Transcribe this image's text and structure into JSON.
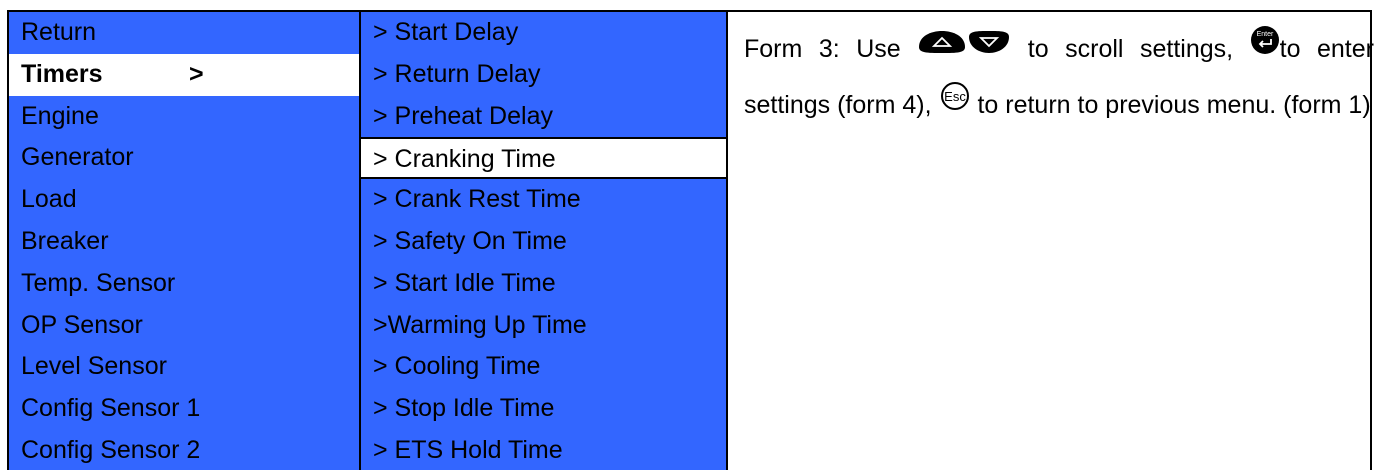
{
  "menu": {
    "items": [
      {
        "label": "Return"
      },
      {
        "label": "Timers",
        "arrow": ">"
      },
      {
        "label": "Engine"
      },
      {
        "label": "Generator"
      },
      {
        "label": "Load"
      },
      {
        "label": "Breaker"
      },
      {
        "label": "Temp. Sensor"
      },
      {
        "label": "OP Sensor"
      },
      {
        "label": "Level Sensor"
      },
      {
        "label": "Config Sensor 1"
      },
      {
        "label": "Config Sensor 2"
      }
    ],
    "selected_index": 1
  },
  "submenu": {
    "items": [
      {
        "label": "> Start Delay"
      },
      {
        "label": "> Return Delay"
      },
      {
        "label": "> Preheat Delay"
      },
      {
        "label": "> Cranking Time"
      },
      {
        "label": "> Crank Rest Time"
      },
      {
        "label": "> Safety On Time"
      },
      {
        "label": "> Start Idle Time"
      },
      {
        "label": ">Warming Up Time"
      },
      {
        "label": "> Cooling Time"
      },
      {
        "label": "> Stop Idle Time"
      },
      {
        "label": "> ETS Hold Time"
      }
    ],
    "selected_index": 3
  },
  "description": {
    "part1": "Form 3: Use ",
    "part2": " to scroll settings, ",
    "part3": "to enter settings (form 4), ",
    "part4": " to return to previous menu. (form 1)",
    "icons": [
      "up-key-icon",
      "down-key-icon",
      "enter-key-icon",
      "esc-key-icon"
    ],
    "enter_icon_text": "Enter",
    "esc_icon_text": "Esc"
  },
  "colors": {
    "menu_bg": "#3366ff",
    "selected_bg": "#ffffff"
  }
}
